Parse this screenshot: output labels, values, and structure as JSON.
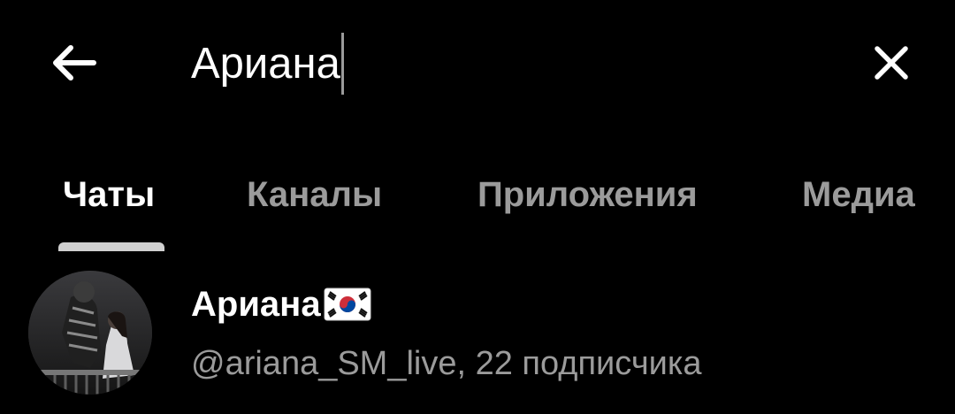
{
  "search": {
    "query": "Ариана",
    "back_icon": "arrow-left-icon",
    "clear_icon": "close-icon"
  },
  "tabs": [
    {
      "label": "Чаты",
      "active": true
    },
    {
      "label": "Каналы",
      "active": false
    },
    {
      "label": "Приложения",
      "active": false
    },
    {
      "label": "Медиа",
      "active": false
    }
  ],
  "results": [
    {
      "title": "Ариана",
      "title_icon": "south-korea-flag-icon",
      "subtitle": "@ariana_SM_live, 22 подписчика"
    }
  ],
  "colors": {
    "background": "#000000",
    "text_primary": "#ffffff",
    "text_secondary": "#9b9b9b",
    "tab_indicator": "#d0d0d0"
  }
}
